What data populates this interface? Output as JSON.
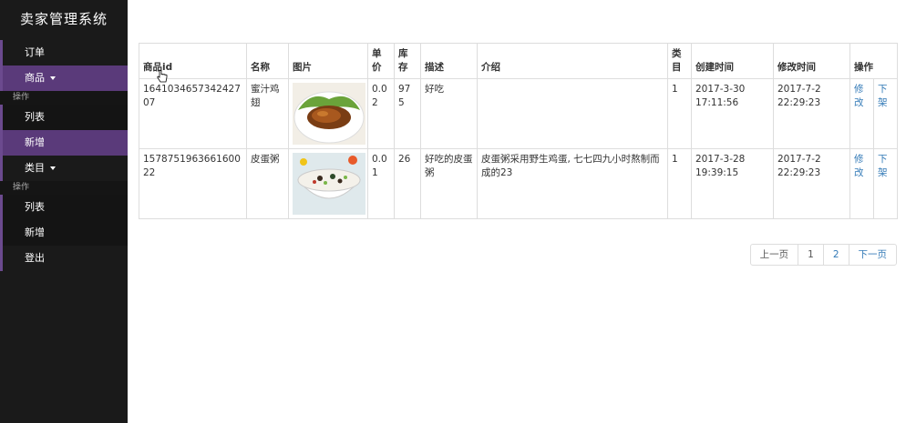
{
  "sidebar": {
    "brand": "卖家管理系统",
    "items": [
      {
        "label": "订单"
      },
      {
        "label": "商品"
      },
      {
        "header": "操作"
      },
      {
        "label": "列表"
      },
      {
        "label": "新增"
      },
      {
        "label": "类目"
      },
      {
        "header": "操作"
      },
      {
        "label": "列表"
      },
      {
        "label": "新增"
      },
      {
        "label": "登出"
      }
    ]
  },
  "table": {
    "headers": [
      "商品id",
      "名称",
      "图片",
      "单价",
      "库存",
      "描述",
      "介绍",
      "类目",
      "创建时间",
      "修改时间",
      "操作"
    ],
    "rows": [
      {
        "id": "164103465734242707",
        "name": "蜜汁鸡翅",
        "image": "chicken-wings-image",
        "price": "0.02",
        "stock": "975",
        "desc": "好吃",
        "intro": "",
        "category": "1",
        "created": "2017-3-30 17:11:56",
        "modified": "2017-7-2 22:29:23",
        "edit": "修改",
        "offline": "下架"
      },
      {
        "id": "157875196366160022",
        "name": "皮蛋粥",
        "image": "congee-image",
        "price": "0.01",
        "stock": "26",
        "desc": "好吃的皮蛋粥",
        "intro": "皮蛋粥采用野生鸡蛋, 七七四九小时熬制而成的23",
        "category": "1",
        "created": "2017-3-28 19:39:15",
        "modified": "2017-7-2 22:29:23",
        "edit": "修改",
        "offline": "下架"
      }
    ]
  },
  "pagination": {
    "prev": "上一页",
    "pages": [
      "1",
      "2"
    ],
    "next": "下一页"
  },
  "colors": {
    "sidebar_bg": "#1a1a1a",
    "active_purple": "#5a3a7a",
    "link": "#337ab7"
  }
}
